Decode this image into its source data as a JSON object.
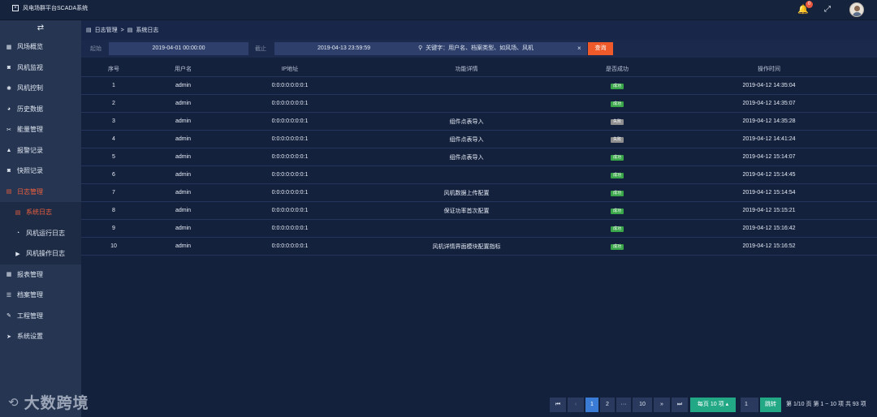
{
  "header": {
    "app_title": "风电场群平台SCADA系统",
    "notification_count": "0"
  },
  "sidebar": {
    "items": [
      {
        "label": "风场概览",
        "icon": "grid-icon"
      },
      {
        "label": "风机监视",
        "icon": "camera-icon"
      },
      {
        "label": "风机控制",
        "icon": "gear-icon"
      },
      {
        "label": "历史数据",
        "icon": "pie-icon"
      },
      {
        "label": "能量管理",
        "icon": "tools-icon"
      },
      {
        "label": "报警记录",
        "icon": "bell-icon"
      },
      {
        "label": "快照记录",
        "icon": "camera-icon"
      },
      {
        "label": "日志管理",
        "icon": "book-icon"
      },
      {
        "label": "系统日志",
        "icon": "book-icon"
      },
      {
        "label": "风机运行日志",
        "icon": "gauge-icon"
      },
      {
        "label": "风机操作日志",
        "icon": "play-icon"
      },
      {
        "label": "报表管理",
        "icon": "table-icon"
      },
      {
        "label": "档案管理",
        "icon": "list-icon"
      },
      {
        "label": "工程管理",
        "icon": "wrench-icon"
      },
      {
        "label": "系统设置",
        "icon": "send-icon"
      }
    ]
  },
  "breadcrumb": {
    "parent": "日志管理",
    "separator": ">",
    "current": "系统日志"
  },
  "filter": {
    "start_label": "起始",
    "start_value": "2019-04-01 00:00:00",
    "end_label": "截止",
    "end_value": "2019-04-13 23:59:59",
    "search_placeholder": "关键字：用户名、档案类型、如风场、风机",
    "clear_symbol": "×",
    "query_button": "查询"
  },
  "table": {
    "columns": [
      "序号",
      "用户名",
      "IP地址",
      "功能详情",
      "是否成功",
      "操作时间"
    ],
    "rows": [
      {
        "no": "1",
        "user": "admin",
        "ip": "0:0:0:0:0:0:0:1",
        "detail": "",
        "success": "成功",
        "ok": true,
        "time": "2019-04-12 14:35:04"
      },
      {
        "no": "2",
        "user": "admin",
        "ip": "0:0:0:0:0:0:0:1",
        "detail": "",
        "success": "成功",
        "ok": true,
        "time": "2019-04-12 14:35:07"
      },
      {
        "no": "3",
        "user": "admin",
        "ip": "0:0:0:0:0:0:0:1",
        "detail": "组件点表导入",
        "success": "失败",
        "ok": false,
        "time": "2019-04-12 14:35:28"
      },
      {
        "no": "4",
        "user": "admin",
        "ip": "0:0:0:0:0:0:0:1",
        "detail": "组件点表导入",
        "success": "失败",
        "ok": false,
        "time": "2019-04-12 14:41:24"
      },
      {
        "no": "5",
        "user": "admin",
        "ip": "0:0:0:0:0:0:0:1",
        "detail": "组件点表导入",
        "success": "成功",
        "ok": true,
        "time": "2019-04-12 15:14:07"
      },
      {
        "no": "6",
        "user": "admin",
        "ip": "0:0:0:0:0:0:0:1",
        "detail": "",
        "success": "成功",
        "ok": true,
        "time": "2019-04-12 15:14:45"
      },
      {
        "no": "7",
        "user": "admin",
        "ip": "0:0:0:0:0:0:0:1",
        "detail": "风机数据上传配置",
        "success": "成功",
        "ok": true,
        "time": "2019-04-12 15:14:54"
      },
      {
        "no": "8",
        "user": "admin",
        "ip": "0:0:0:0:0:0:0:1",
        "detail": "保证功率首次配置",
        "success": "成功",
        "ok": true,
        "time": "2019-04-12 15:15:21"
      },
      {
        "no": "9",
        "user": "admin",
        "ip": "0:0:0:0:0:0:0:1",
        "detail": "",
        "success": "成功",
        "ok": true,
        "time": "2019-04-12 15:16:42"
      },
      {
        "no": "10",
        "user": "admin",
        "ip": "0:0:0:0:0:0:0:1",
        "detail": "风机详情界面模块配置指标",
        "success": "成功",
        "ok": true,
        "time": "2019-04-12 15:16:52"
      }
    ]
  },
  "pagination": {
    "first": "⏮",
    "prev": "‹",
    "pages": [
      "1",
      "2",
      "···",
      "10"
    ],
    "next": "»",
    "last": "⏭",
    "per_page": "每页 10 项",
    "page_input": "1",
    "jump_button": "跳转",
    "page_info": "第 1/10 页",
    "range_info": "第 1 ~ 10 项",
    "total_info": "共 93 项"
  },
  "watermark": {
    "text": "大数跨境"
  },
  "colors": {
    "accent": "#f0603d",
    "success": "#3aa64a",
    "fail": "#8d8d8d",
    "page_active": "#3a7bd5",
    "green_button": "#22a885"
  }
}
